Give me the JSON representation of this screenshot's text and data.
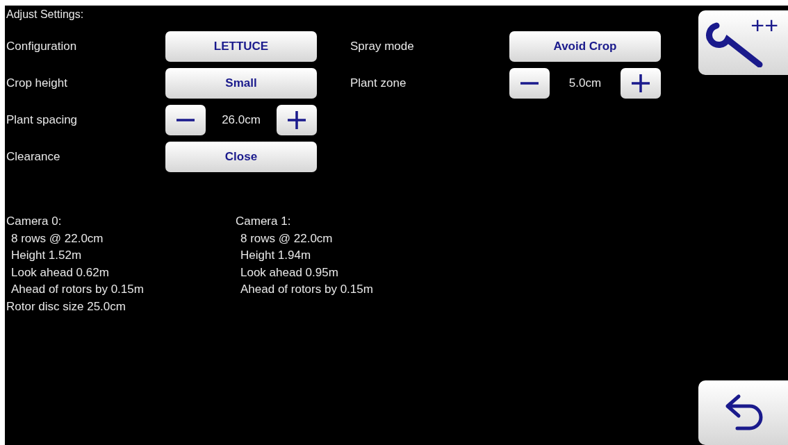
{
  "title": "Adjust Settings:",
  "settings_left": [
    {
      "label": "Configuration",
      "kind": "choice",
      "value": "LETTUCE"
    },
    {
      "label": "Crop height",
      "kind": "choice",
      "value": "Small"
    },
    {
      "label": "Plant spacing",
      "kind": "stepper",
      "value": "26.0cm"
    },
    {
      "label": "Clearance",
      "kind": "choice",
      "value": "Close"
    }
  ],
  "settings_right": [
    {
      "label": "Spray mode",
      "kind": "choice",
      "value": "Avoid Crop"
    },
    {
      "label": "Plant zone",
      "kind": "stepper",
      "value": "5.0cm"
    }
  ],
  "camera_panels": [
    {
      "title": "Camera 0:",
      "details": [
        "8 rows @ 22.0cm",
        "Height 1.52m",
        "Look ahead 0.62m",
        "Ahead of rotors by 0.15m"
      ],
      "footer": "Rotor disc size 25.0cm"
    },
    {
      "title": "Camera 1:",
      "details": [
        "8 rows @ 22.0cm",
        "Height 1.94m",
        "Look ahead 0.95m",
        "Ahead of rotors by 0.15m"
      ]
    }
  ],
  "tools_button": {
    "label": "++"
  }
}
